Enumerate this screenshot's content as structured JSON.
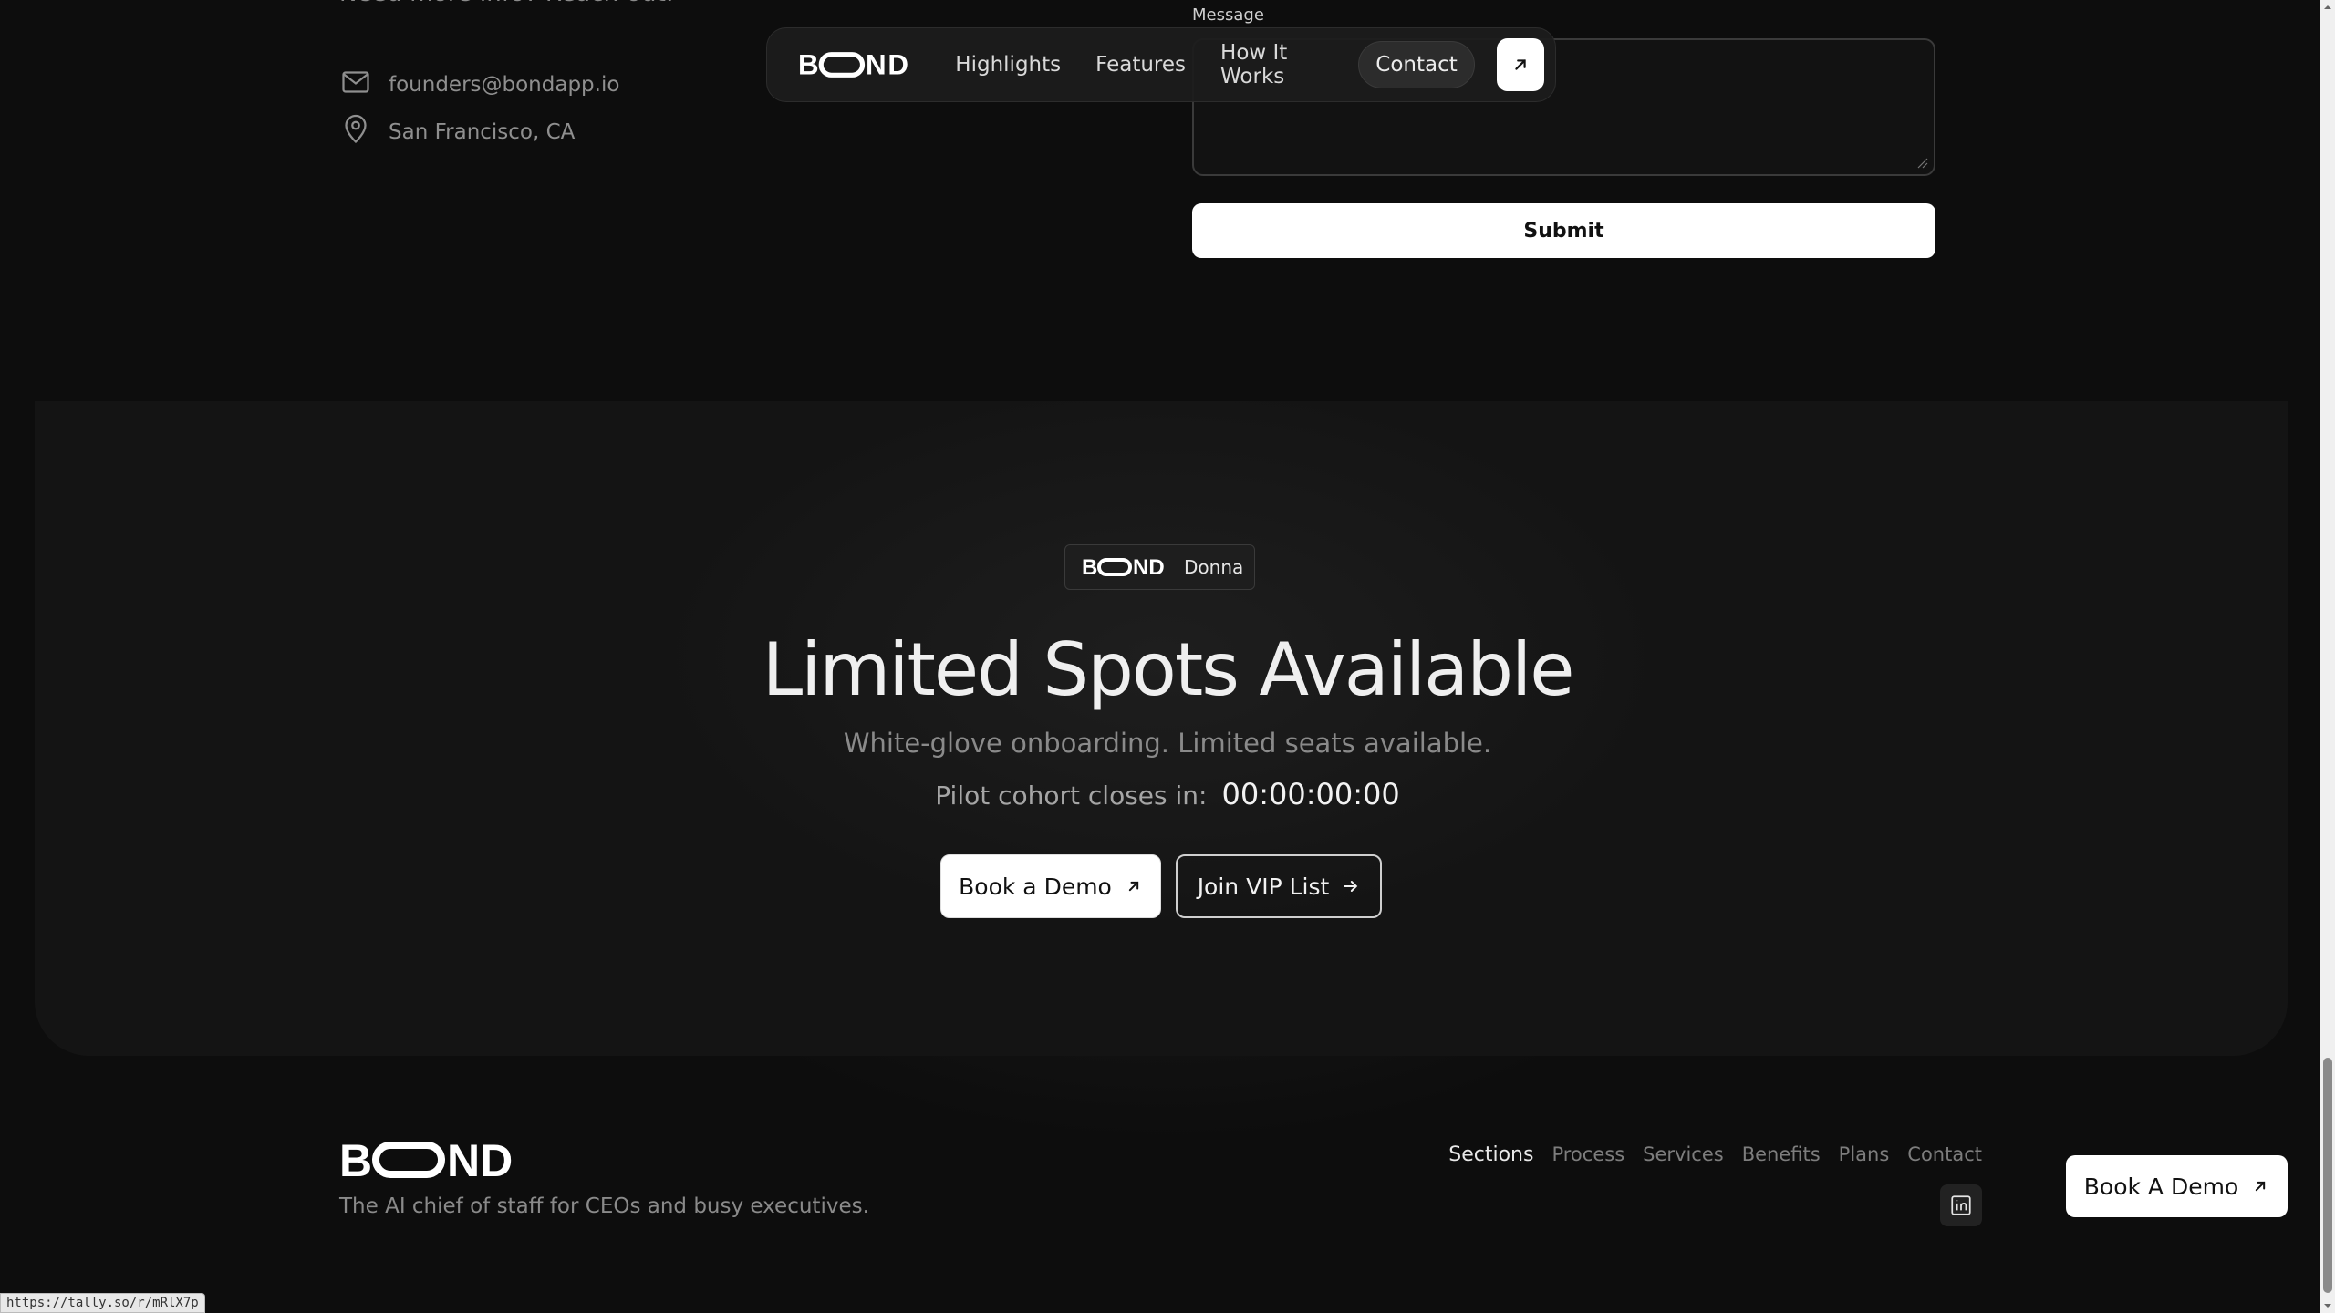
{
  "contact": {
    "reach_out": "Need more info? Reach out.",
    "email": "founders@bondapp.io",
    "location": "San Francisco, CA",
    "message_label": "Message",
    "message_value": "",
    "submit_label": "Submit"
  },
  "nav": {
    "logo": "BOND",
    "links": [
      "Highlights",
      "Features",
      "How It Works",
      "Contact"
    ],
    "active": "Contact",
    "cta_icon": "arrow-up-right-icon"
  },
  "hero": {
    "badge_logo": "BOND",
    "badge_text": "Donna",
    "title": "Limited Spots Available",
    "subtitle": "White-glove onboarding. Limited seats available.",
    "countdown_label": "Pilot cohort closes in:",
    "countdown_value": "00:00:00:00",
    "primary_button": "Book a Demo",
    "secondary_button": "Join VIP List"
  },
  "footer": {
    "logo": "BOND",
    "tagline": "The AI chief of staff for CEOs and busy executives.",
    "nav_heading": "Sections",
    "nav_links": [
      "Process",
      "Services",
      "Benefits",
      "Plans",
      "Contact"
    ],
    "social_icon": "linkedin-icon",
    "cta": "Book A Demo"
  },
  "status_bar": {
    "url": "https://tally.so/r/mRlX7p"
  },
  "colors": {
    "background": "#0d0d0d",
    "card": "#171717",
    "button_bg": "#ffffff",
    "muted_text": "#8a8a8a"
  }
}
